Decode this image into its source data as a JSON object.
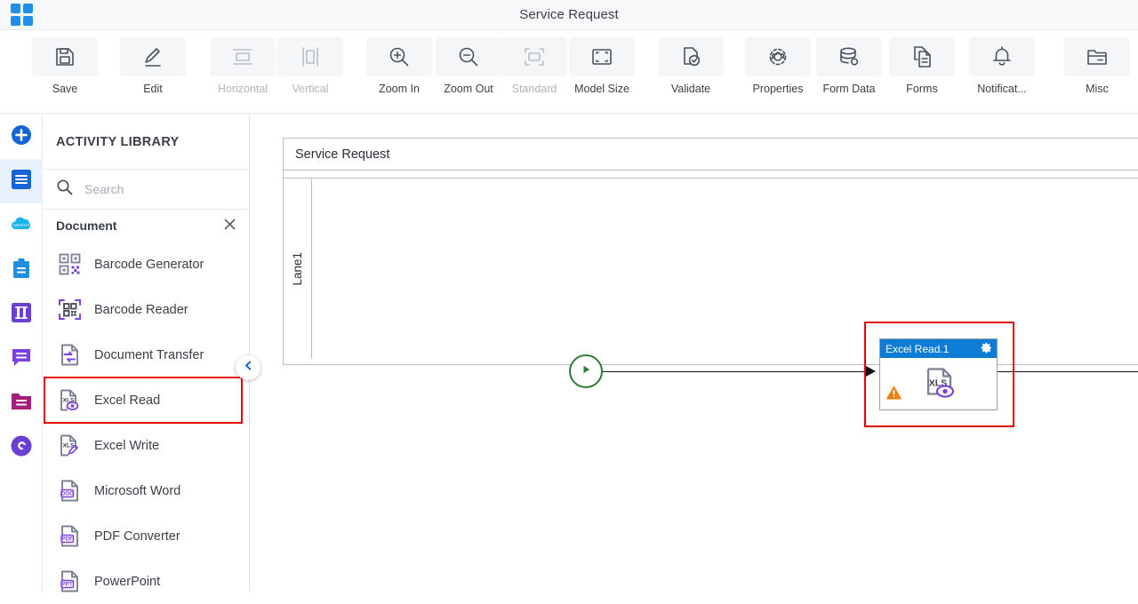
{
  "titlebar": {
    "logo_icon": "grid-apps-icon",
    "title": "Service Request"
  },
  "toolbar": {
    "items": [
      {
        "label": "Save",
        "icon": "save-disk-icon",
        "caret": true,
        "disabled": false
      },
      {
        "label": "Edit",
        "icon": "pencil-edit-icon",
        "caret": true,
        "disabled": false
      },
      {
        "label": "Horizontal",
        "icon": "align-horizontal-icon",
        "caret": false,
        "disabled": true
      },
      {
        "label": "Vertical",
        "icon": "align-vertical-icon",
        "caret": false,
        "disabled": true
      },
      {
        "label": "Zoom In",
        "icon": "zoom-in-icon",
        "caret": false,
        "disabled": false
      },
      {
        "label": "Zoom Out",
        "icon": "zoom-out-icon",
        "caret": false,
        "disabled": false
      },
      {
        "label": "Standard",
        "icon": "standard-size-icon",
        "caret": false,
        "disabled": true
      },
      {
        "label": "Model Size",
        "icon": "model-size-icon",
        "caret": false,
        "disabled": false
      },
      {
        "label": "Validate",
        "icon": "validate-doc-check-icon",
        "caret": false,
        "disabled": false
      },
      {
        "label": "Properties",
        "icon": "gear-icon",
        "caret": true,
        "disabled": false
      },
      {
        "label": "Form Data",
        "icon": "database-icon",
        "caret": false,
        "disabled": false
      },
      {
        "label": "Forms",
        "icon": "forms-copy-icon",
        "caret": false,
        "disabled": false
      },
      {
        "label": "Notificat...",
        "icon": "bell-icon",
        "caret": true,
        "disabled": false
      },
      {
        "label": "Misc",
        "icon": "folder-icon",
        "caret": true,
        "disabled": false
      }
    ]
  },
  "rail": {
    "items": [
      {
        "icon": "plus-circle-icon",
        "color": "#1565d8",
        "active": false
      },
      {
        "icon": "menu-lines-icon",
        "color": "#1565d8",
        "active": true
      },
      {
        "icon": "salesforce-cloud-icon",
        "color": "#19b5ea",
        "active": false
      },
      {
        "icon": "clipboard-icon",
        "color": "#1e8fe0",
        "active": false
      },
      {
        "icon": "columns-icon",
        "color": "#6b3fd4",
        "active": false
      },
      {
        "icon": "chat-bubble-icon",
        "color": "#7b3fe4",
        "active": false
      },
      {
        "icon": "folder-lines-icon",
        "color": "#a51e7c",
        "active": false
      },
      {
        "icon": "swirl-brand-icon",
        "color": "#6b3fd4",
        "active": false
      }
    ]
  },
  "library": {
    "title": "ACTIVITY LIBRARY",
    "search": {
      "placeholder": "Search",
      "value": "",
      "icon": "search-icon"
    },
    "group": {
      "label": "Document",
      "close_icon": "close-icon"
    },
    "items": [
      {
        "label": "Barcode Generator",
        "icon": "barcode-generator-icon",
        "selected": false
      },
      {
        "label": "Barcode Reader",
        "icon": "barcode-reader-icon",
        "selected": false
      },
      {
        "label": "Document Transfer",
        "icon": "document-transfer-icon",
        "selected": false
      },
      {
        "label": "Excel Read",
        "icon": "excel-read-icon",
        "selected": true
      },
      {
        "label": "Excel Write",
        "icon": "excel-write-icon",
        "selected": false
      },
      {
        "label": "Microsoft Word",
        "icon": "word-doc-icon",
        "selected": false
      },
      {
        "label": "PDF Converter",
        "icon": "pdf-doc-icon",
        "selected": false
      },
      {
        "label": "PowerPoint",
        "icon": "ppt-doc-icon",
        "selected": false
      }
    ],
    "collapse_icon": "chevron-left-icon"
  },
  "canvas": {
    "diagram_title": "Service Request",
    "lane_label": "Lane1",
    "start_node": {
      "icon": "start-play-icon"
    },
    "end_node": {
      "icon": "end-stop-icon"
    },
    "task": {
      "title": "Excel Read.1",
      "settings_icon": "gear-icon",
      "warning_icon": "warning-triangle-icon",
      "glyph_icon": "excel-read-icon",
      "glyph_text": "XLS"
    }
  },
  "colors": {
    "accent_blue": "#1565d8",
    "task_header": "#0c7cd5",
    "selection_red": "#e60000",
    "start_green": "#2d7d32",
    "end_red": "#c62828",
    "warning_orange": "#e8820c",
    "icon_purple": "#7b3fe4"
  }
}
